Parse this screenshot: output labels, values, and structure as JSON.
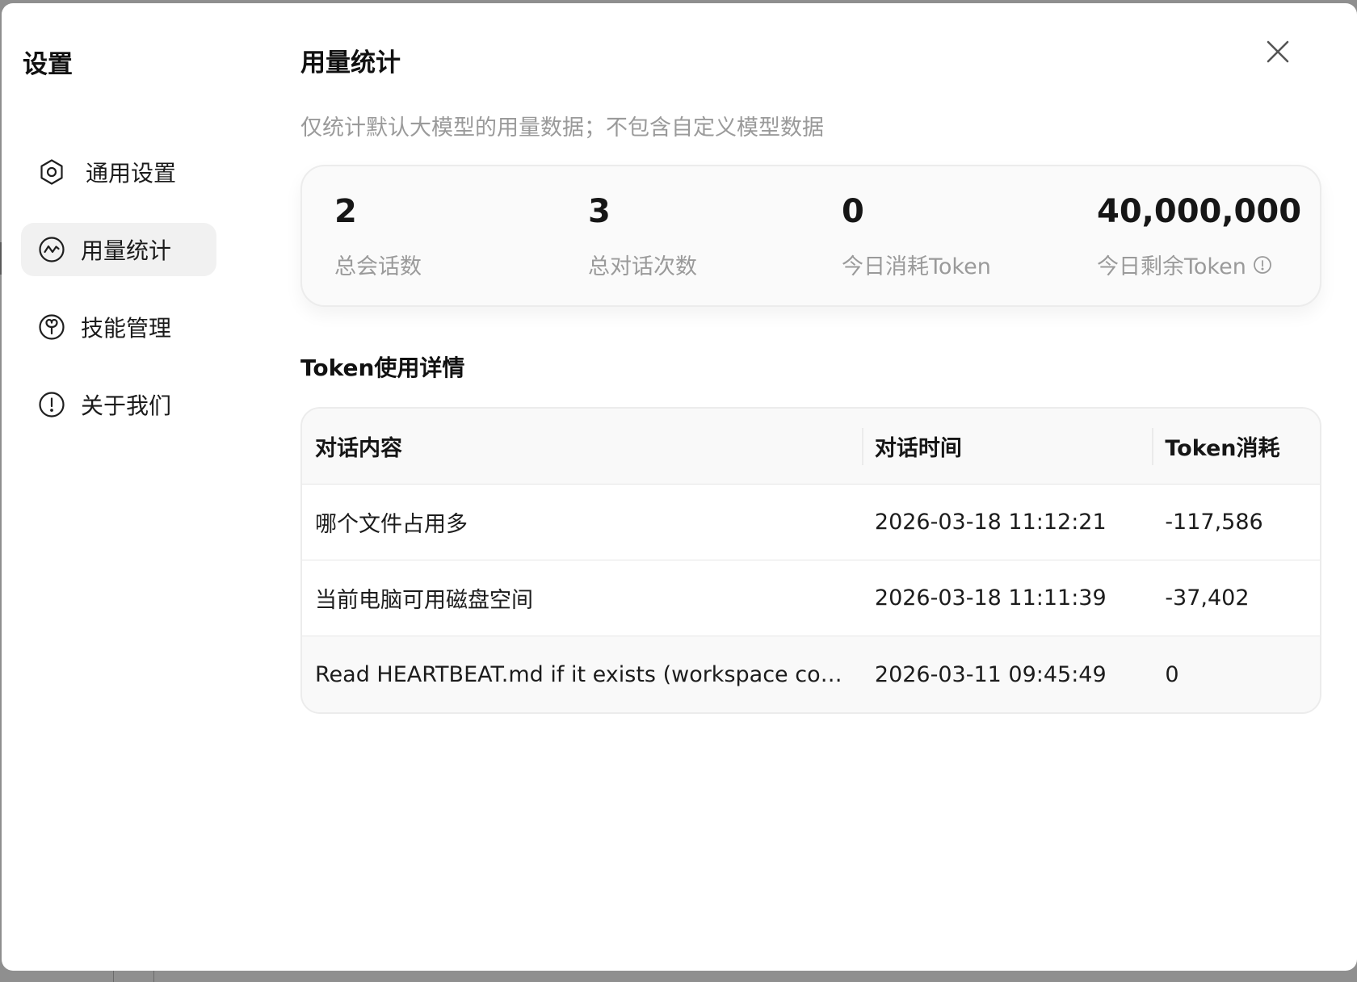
{
  "sidebar": {
    "title": "设置",
    "items": [
      {
        "label": "通用设置",
        "icon": "gear-icon"
      },
      {
        "label": "用量统计",
        "icon": "chart-icon",
        "active": true
      },
      {
        "label": "技能管理",
        "icon": "skill-icon"
      },
      {
        "label": "关于我们",
        "icon": "info-icon"
      }
    ]
  },
  "main": {
    "title": "用量统计",
    "subtitle": "仅统计默认大模型的用量数据；不包含自定义模型数据",
    "stats": [
      {
        "value": "2",
        "label": "总会话数"
      },
      {
        "value": "3",
        "label": "总对话次数"
      },
      {
        "value": "0",
        "label": "今日消耗Token"
      },
      {
        "value": "40,000,000",
        "label": "今日剩余Token"
      }
    ],
    "section_title": "Token使用详情",
    "table": {
      "headers": [
        "对话内容",
        "对话时间",
        "Token消耗"
      ],
      "rows": [
        [
          "哪个文件占用多",
          "2026-03-18 11:12:21",
          "-117,586"
        ],
        [
          "当前电脑可用磁盘空间",
          "2026-03-18 11:11:39",
          "-37,402"
        ],
        [
          "Read HEARTBEAT.md if it exists (workspace conte...",
          "2026-03-11 09:45:49",
          "0"
        ]
      ]
    }
  },
  "colors": {
    "backdrop": "#8f8f8f",
    "active_nav_bg": "#f1f1f1",
    "muted_text": "#9a9a9a",
    "card_bg": "#fafafa"
  }
}
